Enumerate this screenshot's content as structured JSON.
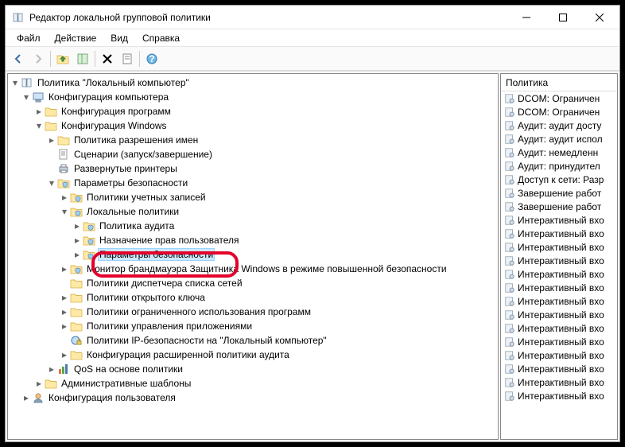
{
  "window": {
    "title": "Редактор локальной групповой политики"
  },
  "menu": {
    "file": "Файл",
    "action": "Действие",
    "view": "Вид",
    "help": "Справка"
  },
  "list": {
    "header": "Политика",
    "items": [
      "DCOM: Ограничен",
      "DCOM: Ограничен",
      "Аудит: аудит досту",
      "Аудит: аудит испол",
      "Аудит: немедленн",
      "Аудит: принудител",
      "Доступ к сети: Разр",
      "Завершение работ",
      "Завершение работ",
      "Интерактивный вхо",
      "Интерактивный вхо",
      "Интерактивный вхо",
      "Интерактивный вхо",
      "Интерактивный вхо",
      "Интерактивный вхо",
      "Интерактивный вхо",
      "Интерактивный вхо",
      "Интерактивный вхо",
      "Интерактивный вхо",
      "Интерактивный вхо",
      "Интерактивный вхо",
      "Интерактивный вхо",
      "Интерактивный вхо"
    ]
  },
  "tree": {
    "root": "Политика \"Локальный компьютер\"",
    "comp_config": "Конфигурация компьютера",
    "prog_config": "Конфигурация программ",
    "win_config": "Конфигурация Windows",
    "name_policy": "Политика разрешения имен",
    "scripts": "Сценарии (запуск/завершение)",
    "printers": "Развернутые принтеры",
    "security": "Параметры безопасности",
    "account_pol": "Политики учетных записей",
    "local_pol": "Локальные политики",
    "audit_pol": "Политика аудита",
    "rights": "Назначение прав пользователя",
    "sec_params": "Параметры безопасности",
    "firewall": "Монитор брандмауэра Защитника Windows в режиме повышенной безопасности",
    "nlm": "Политики диспетчера списка сетей",
    "pubkey": "Политики открытого ключа",
    "restrict": "Политики ограниченного использования программ",
    "appctrl": "Политики управления приложениями",
    "ipsec": "Политики IP-безопасности на \"Локальный компьютер\"",
    "advaudit": "Конфигурация расширенной политики аудита",
    "qos": "QoS на основе политики",
    "admin_tpl": "Административные шаблоны",
    "user_config": "Конфигурация пользователя"
  }
}
